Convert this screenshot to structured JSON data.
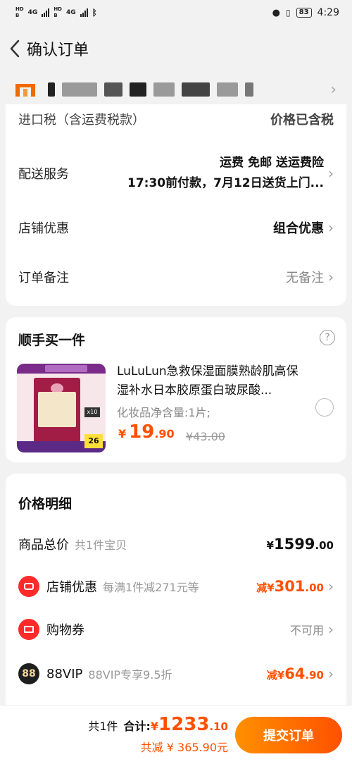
{
  "status_bar": {
    "net1_top": "HD",
    "net1_bottom": "B",
    "net2_top": "HD",
    "net2_bottom": "B",
    "sig1": "4G",
    "sig2": "4G",
    "battery": "83",
    "time": "4:29"
  },
  "header": {
    "title": "确认订单"
  },
  "card_rows": {
    "tax_label": "进口税（含运费税款）",
    "tax_value": "价格已含税",
    "shipping_label": "配送服务",
    "shipping_line1": "运费 免邮 送运费险",
    "shipping_line2": "17:30前付款，7月12日送货上门...",
    "shop_discount_label": "店铺优惠",
    "shop_discount_value": "组合优惠",
    "note_label": "订单备注",
    "note_value": "无备注"
  },
  "addon": {
    "title": "顺手买一件",
    "product_name": "LuLuLun急救保湿面膜熟龄肌高保湿补水日本胶原蛋白玻尿酸...",
    "spec": "化妆品净含量:1片;",
    "price_currency": "¥",
    "price_int": "19",
    "price_dec": ".90",
    "old_price": "¥43.00",
    "img_badge_x10": "x10",
    "img_badge_price": "26"
  },
  "price_detail": {
    "title": "价格明细",
    "goods_label": "商品总价",
    "goods_sub": "共1件宝贝",
    "goods_cur": "¥",
    "goods_int": "1599",
    "goods_dec": ".00",
    "shop_label": "店铺优惠",
    "shop_sub": "每满1件减271元等",
    "shop_prefix": "减",
    "shop_cur": "¥",
    "shop_int": "301",
    "shop_dec": ".00",
    "coupon_label": "购物券",
    "coupon_value": "不可用",
    "vip_icon": "88",
    "vip_label": "88VIP",
    "vip_sub": "88VIP专享9.5折",
    "vip_prefix": "减",
    "vip_cur": "¥",
    "vip_int": "64",
    "vip_dec": ".90"
  },
  "bottom_bar": {
    "count": "共1件",
    "total_label": "合计:",
    "total_cur": "¥",
    "total_int": "1233",
    "total_dec": ".10",
    "saved": "共减 ¥ 365.90元",
    "submit_label": "提交订单"
  },
  "colors": {
    "accent": "#ff5000",
    "submit_gradient_start": "#ff9000",
    "background": "#f2f2f2"
  },
  "icons": [
    "back-icon",
    "chevron-right-icon",
    "help-icon",
    "shop-discount-icon",
    "coupon-icon",
    "vip-88-icon",
    "radio-icon",
    "bluetooth-icon",
    "location-icon",
    "vibrate-icon"
  ]
}
